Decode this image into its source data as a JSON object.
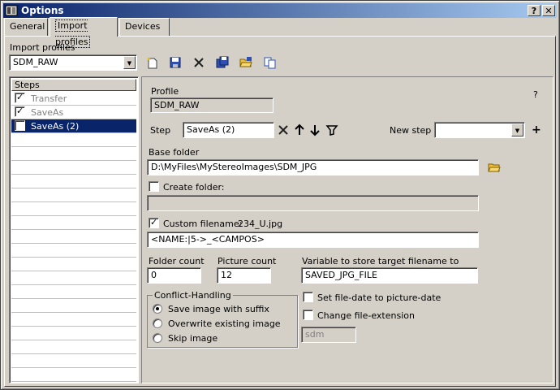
{
  "window": {
    "title": "Options",
    "help_button": "?",
    "close_button": "✕"
  },
  "tabs": [
    {
      "label": "General"
    },
    {
      "label": "Import profiles"
    },
    {
      "label": "Devices"
    }
  ],
  "import_profiles": {
    "label": "Import profiles",
    "selected": "SDM_RAW"
  },
  "toolbar_icons": [
    "new-profile-icon",
    "save-profile-icon",
    "delete-profile-icon",
    "save-as-profile-icon",
    "open-folder-icon",
    "copy-profile-icon"
  ],
  "steps": {
    "header": "Steps",
    "items": [
      {
        "label": "Transfer",
        "checked": true,
        "dim": true
      },
      {
        "label": "SaveAs",
        "checked": true,
        "dim": true
      },
      {
        "label": "SaveAs (2)",
        "checked": true,
        "selected": true
      }
    ]
  },
  "profile": {
    "label": "Profile",
    "value": "SDM_RAW",
    "help": "?"
  },
  "step": {
    "label": "Step",
    "value": "SaveAs (2)",
    "new_step_label": "New step",
    "new_step_value": "",
    "add_glyph": "+"
  },
  "base_folder": {
    "label": "Base folder",
    "value": "D:\\MyFiles\\MyStereoImages\\SDM_JPG"
  },
  "create_folder": {
    "label": "Create folder:",
    "checked": false,
    "value": ""
  },
  "custom_filename": {
    "label": "Custom filename:",
    "preview": "234_U.jpg",
    "checked": true,
    "value": "<NAME:|5->_<CAMPOS>"
  },
  "folder_count": {
    "label": "Folder count",
    "value": "0"
  },
  "picture_count": {
    "label": "Picture count",
    "value": "12"
  },
  "target_variable": {
    "label": "Variable to store target filename to",
    "value": "SAVED_JPG_FILE"
  },
  "conflict": {
    "title": "Conflict-Handling",
    "options": [
      {
        "label": "Save image with suffix",
        "selected": true
      },
      {
        "label": "Overwrite existing image",
        "selected": false
      },
      {
        "label": "Skip image",
        "selected": false
      }
    ]
  },
  "set_file_date": {
    "label": "Set file-date to picture-date",
    "checked": false
  },
  "change_extension": {
    "label": "Change file-extension",
    "checked": false,
    "value": "sdm"
  },
  "colors": {
    "face": "#d4d0c8",
    "titlebar_start": "#0a246a",
    "titlebar_end": "#a6caf0",
    "selection": "#0a246a",
    "disabled_text": "#808080"
  }
}
